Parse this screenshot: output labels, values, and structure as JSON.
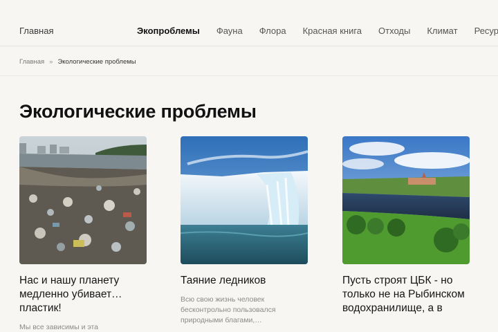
{
  "nav": {
    "home": "Главная",
    "items": [
      {
        "label": "Экопроблемы",
        "active": true
      },
      {
        "label": "Фауна"
      },
      {
        "label": "Флора"
      },
      {
        "label": "Красная книга"
      },
      {
        "label": "Отходы"
      },
      {
        "label": "Климат"
      },
      {
        "label": "Ресурсы"
      }
    ]
  },
  "breadcrumb": {
    "home": "Главная",
    "separator": "»",
    "current": "Экологические проблемы"
  },
  "page": {
    "title": "Экологические проблемы"
  },
  "cards": [
    {
      "title": "Нас и нашу планету медленно убивает… пластик!",
      "desc": "Мы все зависимы и эта",
      "image": "plastic-pollution-beach"
    },
    {
      "title": "Таяние ледников",
      "desc": "Всю свою жизнь человек бесконтрольно пользовался природными благами,…",
      "image": "melting-glacier"
    },
    {
      "title": "Пусть строят ЦБК - но только не на Рыбинском водохранилище, а в",
      "desc": "",
      "image": "river-landscape"
    }
  ]
}
